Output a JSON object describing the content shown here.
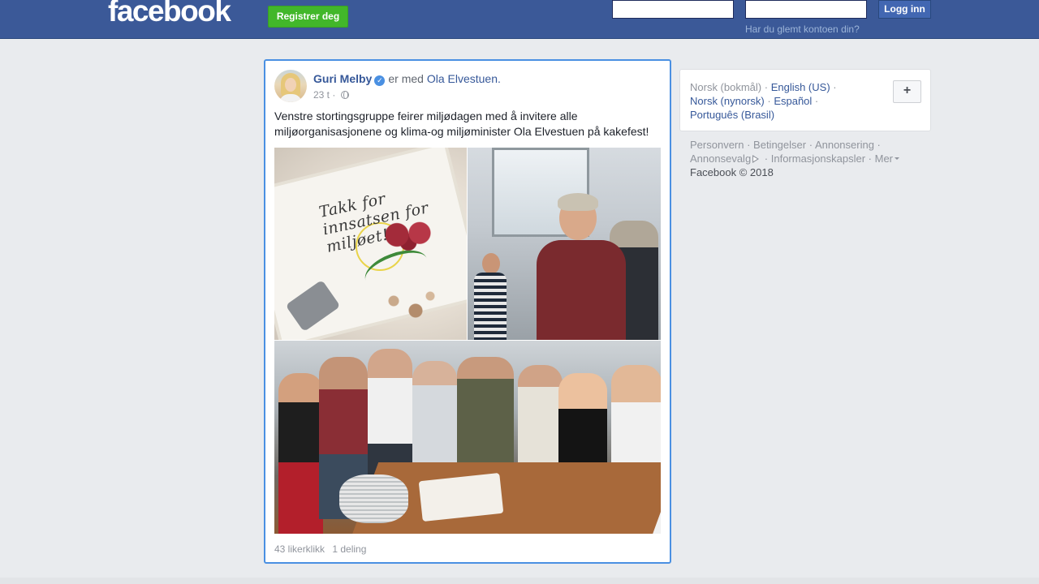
{
  "header": {
    "logo": "facebook",
    "register_label": "Registrer deg",
    "login_label": "Logg inn",
    "forgot_label": "Har du glemt kontoen din?",
    "email_value": "",
    "password_value": ""
  },
  "post": {
    "author": "Guri Melby",
    "with_text": "er med",
    "tagged": "Ola Elvestuen",
    "tagged_suffix": ".",
    "time": "23 t ·",
    "privacy_icon": "globe-icon",
    "text": "Venstre stortingsgruppe feirer miljødagen med å invitere alle miljøorganisasjonene og klima-og miljøminister Ola Elvestuen på kakefest!",
    "cake_text": "Takk for innsatsen for miljøet!",
    "likes": "43 likerklikk",
    "shares": "1 deling"
  },
  "languages": {
    "current": "Norsk (bokmål)",
    "links": [
      "English (US)",
      "Norsk (nynorsk)",
      "Español",
      "Português (Brasil)"
    ],
    "add_label": "+"
  },
  "footer": {
    "links": [
      "Personvern",
      "Betingelser",
      "Annonsering",
      "Annonsevalg",
      "Informasjonskapsler",
      "Mer"
    ],
    "copyright": "Facebook © 2018"
  },
  "colors": {
    "brand": "#3b5998",
    "link": "#365899",
    "register": "#42b72a",
    "post_border": "#4a90e2"
  }
}
